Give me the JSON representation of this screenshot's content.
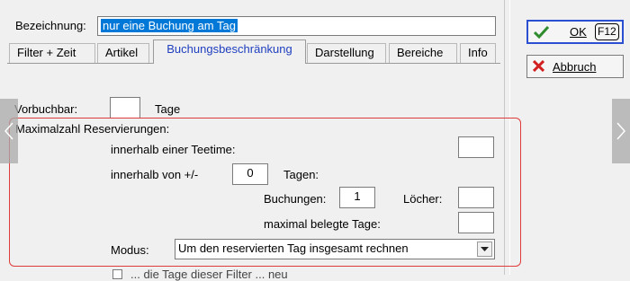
{
  "header": {
    "bezeichnung_label": "Bezeichnung:",
    "bezeichnung_value": "nur eine Buchung am Tag"
  },
  "tabs": [
    {
      "label": "Filter + Zeit"
    },
    {
      "label": "Artikel"
    },
    {
      "label": "Buchungsbeschränkung"
    },
    {
      "label": "Darstellung"
    },
    {
      "label": "Bereiche"
    },
    {
      "label": "Info"
    }
  ],
  "active_tab": "Buchungsbeschränkung",
  "form": {
    "vorbuchbar_label": "Vorbuchbar:",
    "vorbuchbar_value": "",
    "vorbuchbar_unit": "Tage",
    "max_section_label": "Maximalzahl Reservierungen:",
    "teetime_label": "innerhalb einer Teetime:",
    "teetime_value": "",
    "innerhalb_label": "innerhalb von +/-",
    "innerhalb_value": "0",
    "innerhalb_unit": "Tagen:",
    "buchungen_label": "Buchungen:",
    "buchungen_value": "1",
    "loecher_label": "Löcher:",
    "loecher_value": "",
    "belegte_label": "maximal belegte Tage:",
    "belegte_value": "",
    "modus_label": "Modus:",
    "modus_value": "Um den reservierten Tag insgesamt rechnen",
    "cutoff_text": "... die Tage dieser Filter ... neu"
  },
  "buttons": {
    "ok_label": "OK",
    "ok_hotkey": "F12",
    "abbruch_label": "Abbruch"
  },
  "colors": {
    "accent": "#2a4fd0",
    "highlight": "#e03b3b",
    "selection": "#0078d7",
    "ok_check": "#2e8b2e",
    "cancel_x": "#d21f1f"
  }
}
